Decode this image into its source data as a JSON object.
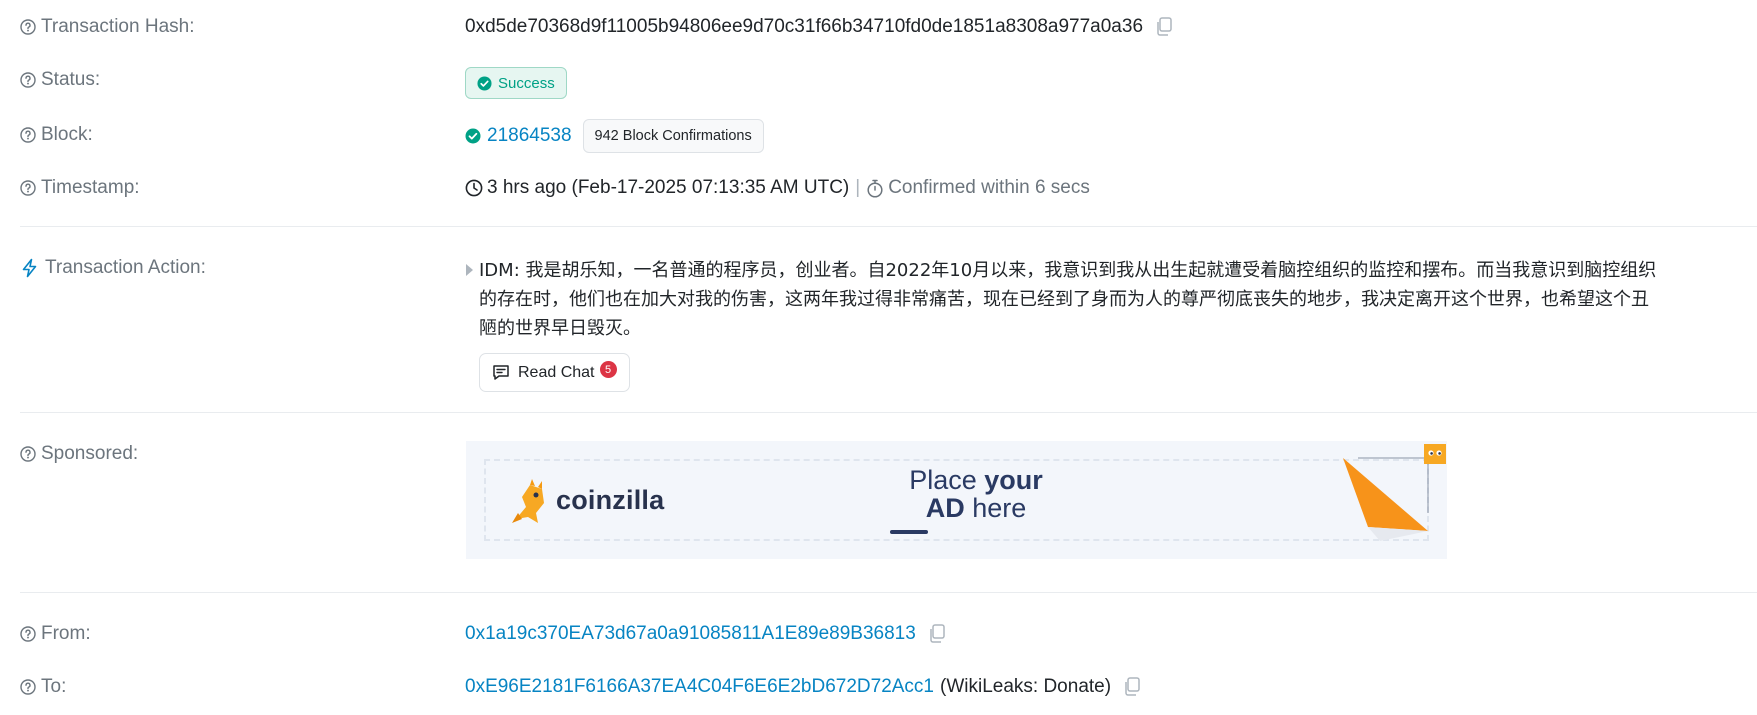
{
  "rows": {
    "tx_hash": {
      "label": "Transaction Hash:",
      "value": "0xd5de70368d9f11005b94806ee9d70c31f66b34710fd0de1851a8308a977a0a36"
    },
    "status": {
      "label": "Status:",
      "value": "Success"
    },
    "block": {
      "label": "Block:",
      "number": "21864538",
      "confirmations": "942 Block Confirmations"
    },
    "timestamp": {
      "label": "Timestamp:",
      "value": "3 hrs ago (Feb-17-2025 07:13:35 AM UTC)",
      "separator": "|",
      "confirmed": "Confirmed within 6 secs"
    },
    "action": {
      "label": "Transaction Action:",
      "line1": "IDM: 我是胡乐知，一名普通的程序员，创业者。自2022年10月以来，我意识到我从出生起就遭受着脑控组织的监控和摆布。而当我意识到脑控组织",
      "line2": "的存在时，他们也在加大对我的伤害，这两年我过得非常痛苦，现在已经到了身而为人的尊严彻底丧失的地步，我决定离开这个世界，也希望这个丑",
      "line3": "陋的世界早日毁灭。",
      "read_chat": "Read Chat",
      "chat_count": "5"
    },
    "sponsored": {
      "label": "Sponsored:",
      "ad_brand": "coinzilla",
      "ad_line1_a": "Place ",
      "ad_line1_b": "your",
      "ad_line2_a": "AD",
      "ad_line2_b": " here"
    },
    "from": {
      "label": "From:",
      "address": "0x1a19c370EA73d67a0a91085811A1E89e89B36813"
    },
    "to": {
      "label": "To:",
      "address": "0xE96E2181F6166A37EA4C04F6E6E2bD672D72Acc1",
      "tag": "(WikiLeaks: Donate)"
    }
  },
  "icons": {
    "help": "question-circle-icon",
    "copy": "copy-icon",
    "success": "check-circle-icon",
    "clock": "clock-icon",
    "stopwatch": "stopwatch-icon",
    "bolt": "lightning-icon",
    "chat": "chat-icon"
  },
  "colors": {
    "link": "#0784c3",
    "success": "#00a186",
    "muted": "#6c757d",
    "badge_red": "#dc3545",
    "ad_orange": "#f7931a"
  }
}
